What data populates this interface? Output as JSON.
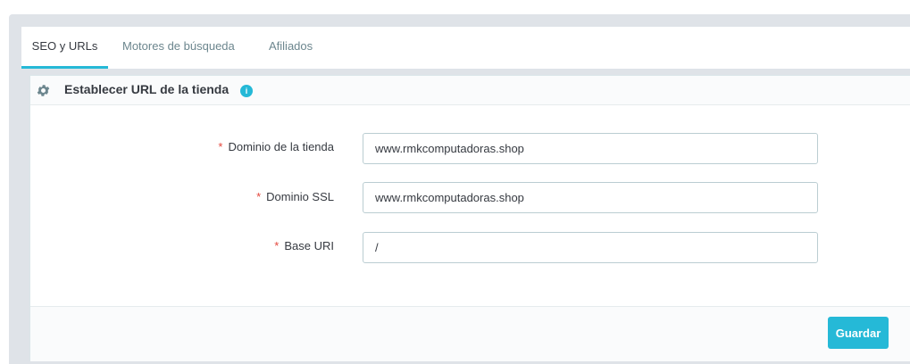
{
  "tabs": [
    {
      "label": "SEO y URLs",
      "active": true
    },
    {
      "label": "Motores de búsqueda",
      "active": false
    },
    {
      "label": "Afiliados",
      "active": false
    }
  ],
  "panel": {
    "title": "Establecer URL de la tienda",
    "title_icon": "gear-icon",
    "info_icon": "info-icon",
    "info_glyph": "i"
  },
  "form": {
    "required_marker": "*",
    "fields": [
      {
        "label": "Dominio de la tienda",
        "value": "www.rmkcomputadoras.shop"
      },
      {
        "label": "Dominio SSL",
        "value": "www.rmkcomputadoras.shop"
      },
      {
        "label": "Base URI",
        "value": "/"
      }
    ]
  },
  "footer": {
    "save_label": "Guardar"
  },
  "colors": {
    "accent": "#25b9d7",
    "required": "#e4473d",
    "text": "#363a41",
    "muted_tab": "#6c868e"
  }
}
